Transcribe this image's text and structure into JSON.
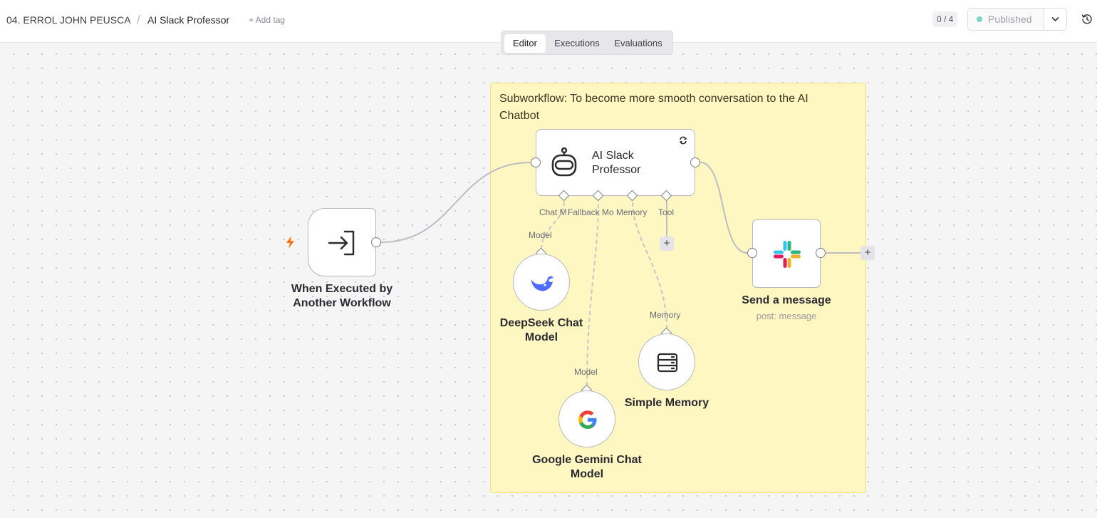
{
  "header": {
    "project": "04. ERROL JOHN PEUSCA",
    "separator": "/",
    "workflow_name": "AI Slack Professor",
    "add_tag": "+ Add tag",
    "counter": "0 / 4",
    "publish_label": "Published",
    "publish_color": "#7dd3c4"
  },
  "tabs": [
    {
      "label": "Editor",
      "active": true
    },
    {
      "label": "Executions",
      "active": false
    },
    {
      "label": "Evaluations",
      "active": false
    }
  ],
  "sticky": {
    "text": "Subworkflow: To become more smooth conversation to the AI Chatbot"
  },
  "nodes": {
    "trigger": {
      "label": "When Executed by Another Workflow",
      "icon": "sign-in-icon",
      "badge_icon": "lightning-icon",
      "badge_color": "#f97316"
    },
    "agent": {
      "label": "AI Slack Professor",
      "icon": "robot-icon",
      "status_icon": "refresh-icon"
    },
    "deepseek": {
      "label": "DeepSeek Chat Model",
      "icon": "deepseek-whale-icon",
      "connector": "Model"
    },
    "gemini": {
      "label": "Google Gemini Chat Model",
      "icon": "google-g-icon",
      "connector": "Model"
    },
    "memory": {
      "label": "Simple Memory",
      "icon": "database-icon",
      "connector": "Memory"
    },
    "slack": {
      "label": "Send a message",
      "sublabel": "post: message",
      "icon": "slack-icon"
    }
  },
  "agent_inputs": [
    "Chat M",
    "Fallback Mo",
    "Memory",
    "Tool"
  ],
  "plus_symbol": "+"
}
